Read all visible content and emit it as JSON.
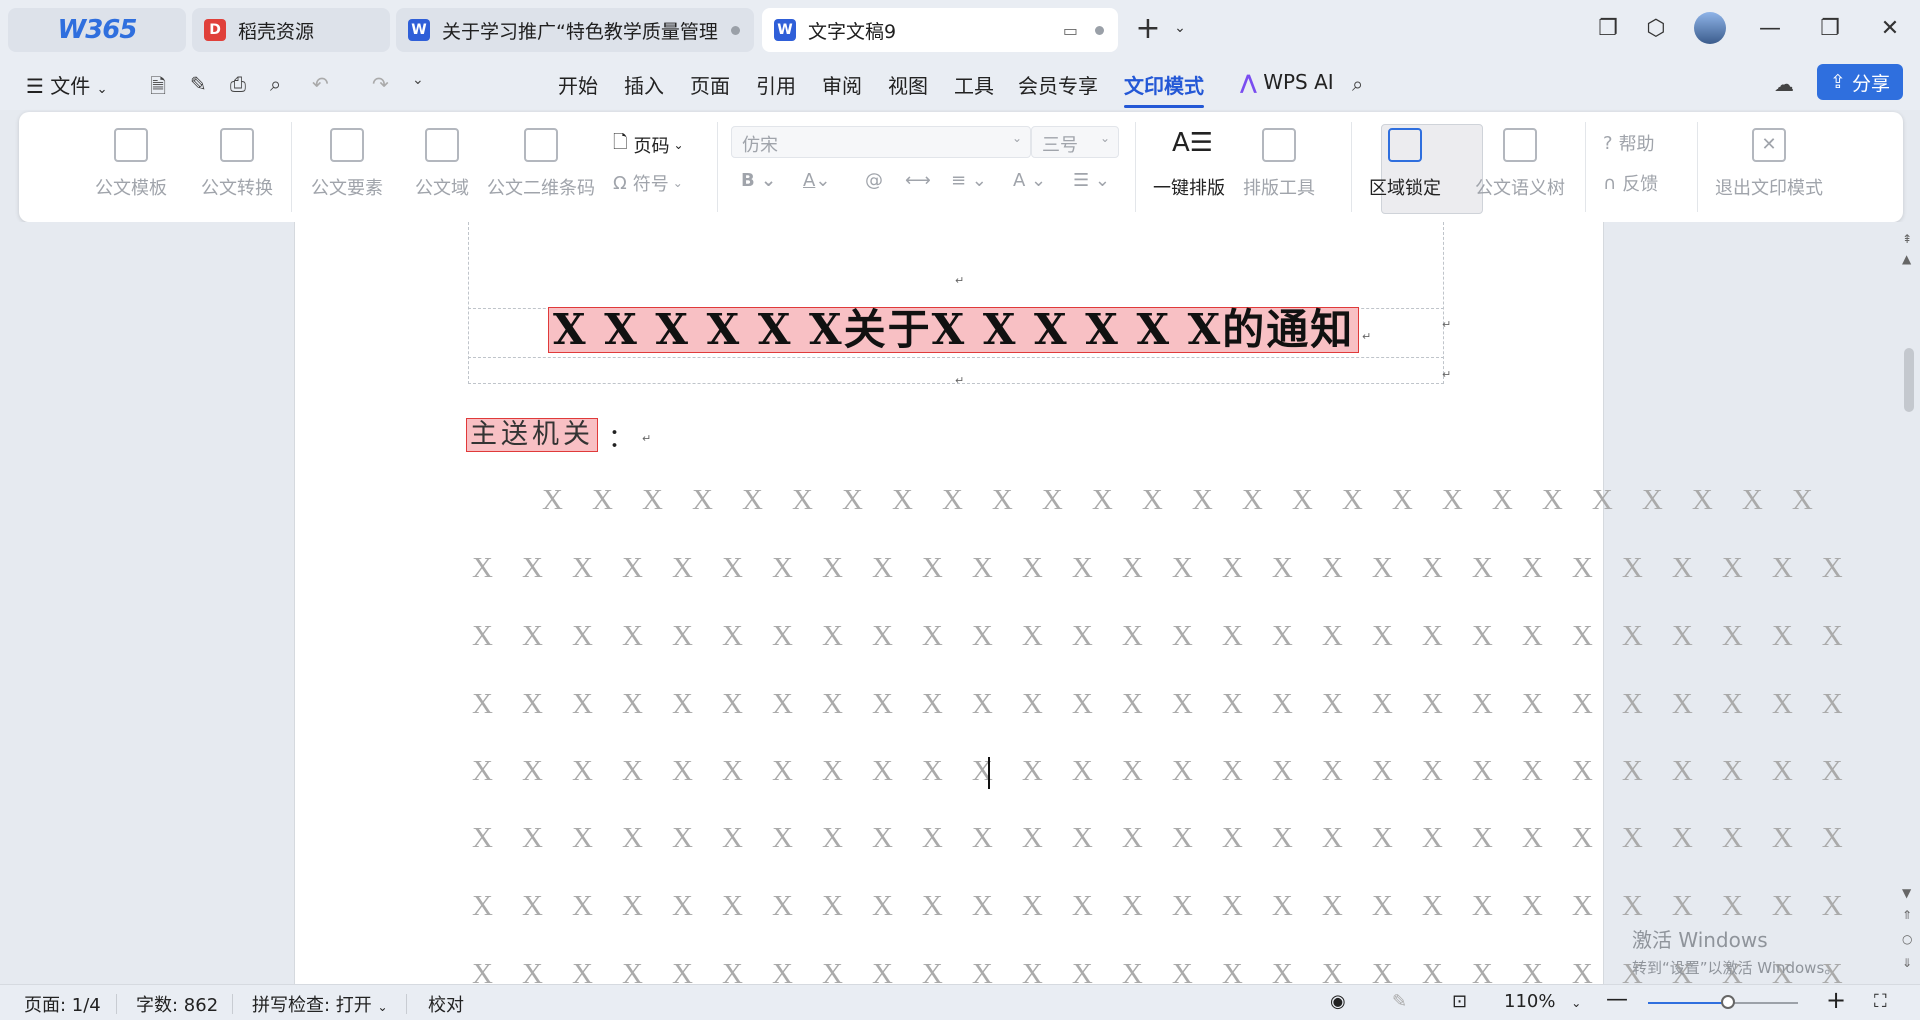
{
  "tabs": [
    {
      "label": "W365",
      "kind": "logo"
    },
    {
      "label": "稻壳资源",
      "kind": "docer"
    },
    {
      "label": "关于学习推广“特色教学质量管理",
      "kind": "wps"
    },
    {
      "label": "文字文稿9",
      "kind": "wps",
      "active": true
    }
  ],
  "menu": {
    "file_label": "文件",
    "items": [
      "开始",
      "插入",
      "页面",
      "引用",
      "审阅",
      "视图",
      "工具",
      "会员专享",
      "文印模式"
    ],
    "active_item": "文印模式",
    "wps_ai": "WPS AI",
    "share": "分享"
  },
  "ribbon": {
    "template": "公文模板",
    "convert": "公文转换",
    "elements": "公文要素",
    "domain": "公文域",
    "qrcode": "公文二维条码",
    "page_number": "页码",
    "symbol": "符号",
    "font": "仿宋",
    "font_size": "三号",
    "one_key": "一键排版",
    "layout_tools": "排版工具",
    "region_lock": "区域锁定",
    "semantic_tree": "公文语义树",
    "help": "帮助",
    "feedback": "反馈",
    "exit": "退出文印模式"
  },
  "document": {
    "title": "X X X X X X关于X X X X X X的通知",
    "recipient": "主送机关",
    "colon": "：",
    "lines": [
      "X X X X X X X X X X X X X X X X X X X X X X X X X X",
      "X X X X X X X X X X X X X X X X X X X X X X X X X X X X",
      "X X X X X X X X X X X X X X X X X X X X X X X X X X X X",
      "X X X X X X X X X X X X X X X X X X X X X X X X X X X X",
      "X X X X X X X X X X X X X X X X X X X X X X X X X X X X",
      "X X X X X X X X X X X X X X X X X X X X X X X X X X X X",
      "X X X X X X X X X X X X X X X X X X X X X X X X X X X X",
      "X X X X X X X X X X X X X X X X X X X X X X X X X X X X"
    ]
  },
  "watermark": {
    "line1": "激活 Windows",
    "line2": "转到“设置”以激活 Windows。"
  },
  "status": {
    "page": "页面: 1/4",
    "words": "字数: 862",
    "spell": "拼写检查: 打开",
    "proof": "校对",
    "zoom": "110%",
    "zoom_fraction": 0.53
  },
  "colors": {
    "accent": "#2458d6",
    "share_bg": "#2f6fde",
    "highlight": "#f8c0c4",
    "highlight_border": "#e03a3a",
    "placeholder_text": "#aaaaaa"
  }
}
